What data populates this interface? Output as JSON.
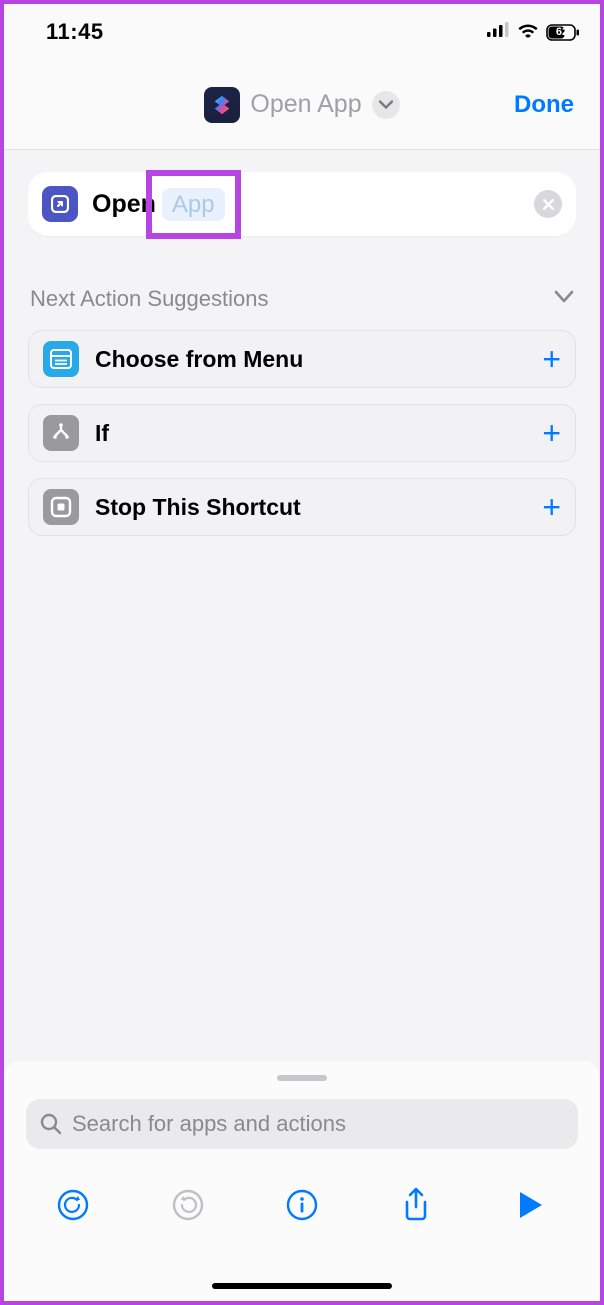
{
  "statusbar": {
    "time": "11:45",
    "battery": "62"
  },
  "header": {
    "title": "Open App",
    "done_label": "Done"
  },
  "action": {
    "open_label": "Open",
    "param_placeholder": "App"
  },
  "suggestions_title": "Next Action Suggestions",
  "suggestions": [
    {
      "label": "Choose from Menu"
    },
    {
      "label": "If"
    },
    {
      "label": "Stop This Shortcut"
    }
  ],
  "search": {
    "placeholder": "Search for apps and actions"
  },
  "colors": {
    "accent": "#007aff",
    "highlight_border": "#b845e3"
  }
}
